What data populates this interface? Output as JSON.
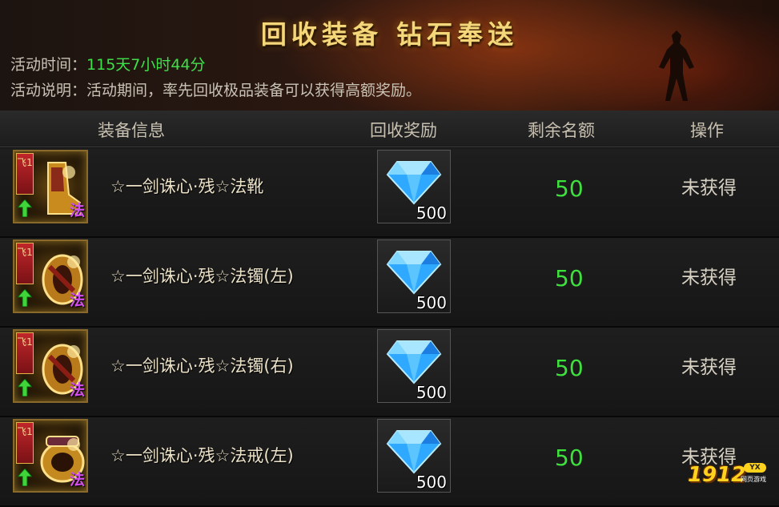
{
  "banner": {
    "title": "回收装备  钻石奉送",
    "time_label": "活动时间：",
    "time_value": "115天7小时44分",
    "desc_label": "活动说明：",
    "desc_value": "活动期间，率先回收极品装备可以获得高额奖励。"
  },
  "table": {
    "headers": [
      "装备信息",
      "回收奖励",
      "剩余名额",
      "操作"
    ],
    "rows": [
      {
        "tag": "飞1",
        "class_badge": "法",
        "name": "☆一剑诛心·残☆法靴",
        "reward_count": "500",
        "quota": "50",
        "action": "未获得",
        "gear_icon": "boots-icon"
      },
      {
        "tag": "飞1",
        "class_badge": "法",
        "name": "☆一剑诛心·残☆法镯(左)",
        "reward_count": "500",
        "quota": "50",
        "action": "未获得",
        "gear_icon": "bracelet-icon"
      },
      {
        "tag": "飞1",
        "class_badge": "法",
        "name": "☆一剑诛心·残☆法镯(右)",
        "reward_count": "500",
        "quota": "50",
        "action": "未获得",
        "gear_icon": "bracelet-icon"
      },
      {
        "tag": "飞1",
        "class_badge": "法",
        "name": "☆一剑诛心·残☆法戒(左)",
        "reward_count": "500",
        "quota": "50",
        "action": "未获得",
        "gear_icon": "ring-icon"
      }
    ]
  },
  "watermark": {
    "number": "1912",
    "badge": "YX",
    "sub": "网页游戏"
  },
  "colors": {
    "gold_title": "#f4d77a",
    "green_value": "#3de03d",
    "class_badge": "#d44ff0"
  }
}
